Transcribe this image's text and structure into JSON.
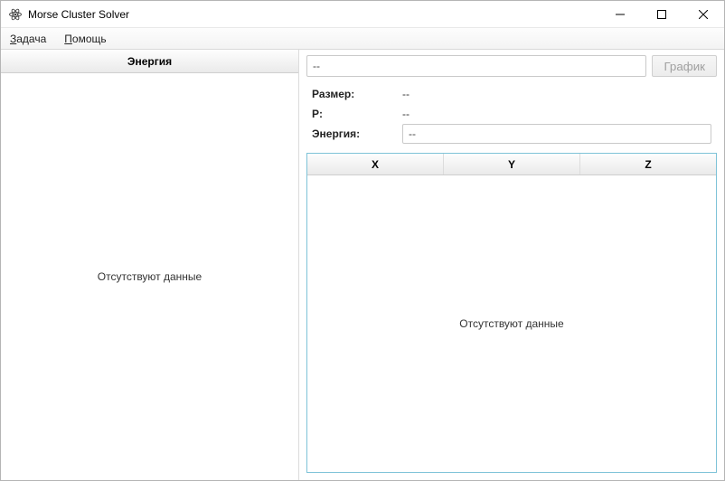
{
  "window": {
    "title": "Morse Cluster Solver"
  },
  "menu": {
    "task": "Задача",
    "help": "Помощь"
  },
  "left_panel": {
    "header": "Энергия",
    "empty_text": "Отсутствуют данные"
  },
  "right_panel": {
    "top_input_value": "--",
    "graph_button": "График",
    "rows": {
      "size_label": "Размер:",
      "size_value": "--",
      "p_label": "P:",
      "p_value": "--",
      "energy_label": "Энергия:",
      "energy_value": "--"
    },
    "table": {
      "columns": {
        "x": "X",
        "y": "Y",
        "z": "Z"
      },
      "empty_text": "Отсутствуют данные"
    }
  }
}
